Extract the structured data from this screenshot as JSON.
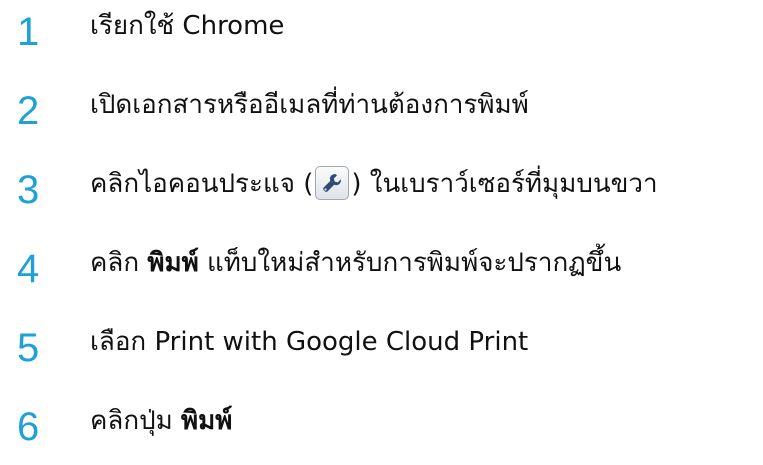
{
  "steps": [
    {
      "number": "1",
      "text": "เรียกใช้ Chrome"
    },
    {
      "number": "2",
      "text": "เปิดเอกสารหรืออีเมลที่ท่านต้องการพิมพ์"
    },
    {
      "number": "3",
      "text_before": "คลิกไอคอนประแจ (",
      "text_after": ") ในเบราว์เซอร์ที่มุมบนขวา",
      "icon": "wrench-icon"
    },
    {
      "number": "4",
      "text_before": "คลิก ",
      "bold": "พิมพ์",
      "text_after": " แท็บใหม่สำหรับการพิมพ์จะปรากฏขึ้น"
    },
    {
      "number": "5",
      "text_before": "เลือก ",
      "emphasis": "Print with Google Cloud Print"
    },
    {
      "number": "6",
      "text_before": "คลิกปุ่ม ",
      "bold": "พิมพ์"
    }
  ],
  "colors": {
    "step_number": "#1ea0d8",
    "text": "#111111",
    "icon_wrench": "#2f4d73"
  }
}
